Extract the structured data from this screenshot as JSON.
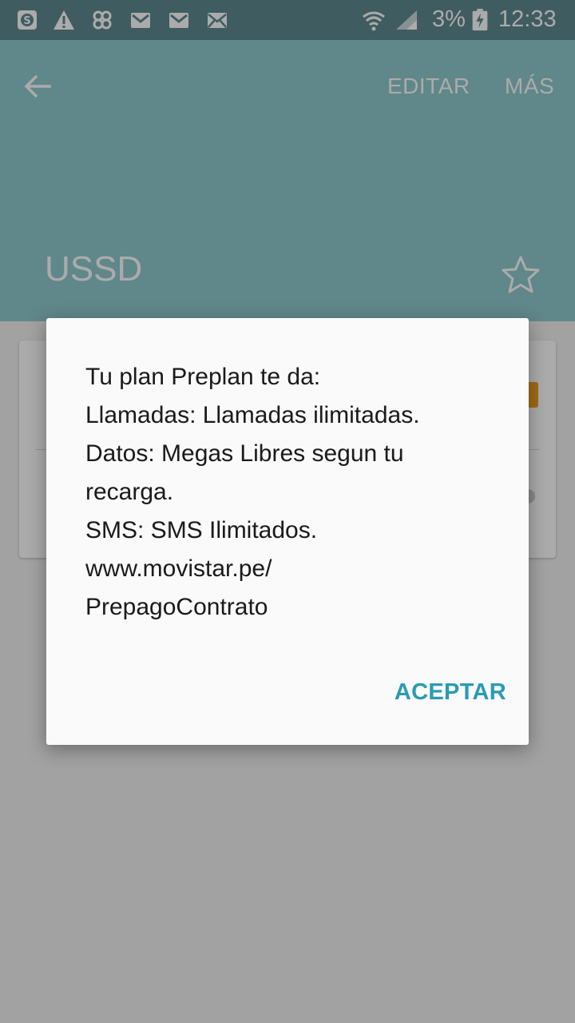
{
  "status_bar": {
    "battery": "3%",
    "time": "12:33",
    "icons": [
      "skype-icon",
      "warning-icon",
      "pinwheel-icon",
      "gmail-icon",
      "gmail-icon",
      "email-icon",
      "wifi-icon",
      "signal-icon",
      "battery-charging-icon"
    ]
  },
  "header": {
    "back_icon": "back-arrow-icon",
    "edit_label": "EDITAR",
    "more_label": "MÁS",
    "title": "USSD",
    "star_icon": "star-outline-icon",
    "bg_color": "#5f8a90"
  },
  "dialog": {
    "lines": [
      "Tu plan Preplan te da:",
      "Llamadas: Llamadas ilimitadas.",
      "Datos: Megas Libres segun tu",
      "recarga.",
      "SMS: SMS Ilimitados.",
      "www.movistar.pe/",
      "PrepagoContrato"
    ],
    "accept_label": "ACEPTAR",
    "accent_color": "#2a9bb5"
  }
}
